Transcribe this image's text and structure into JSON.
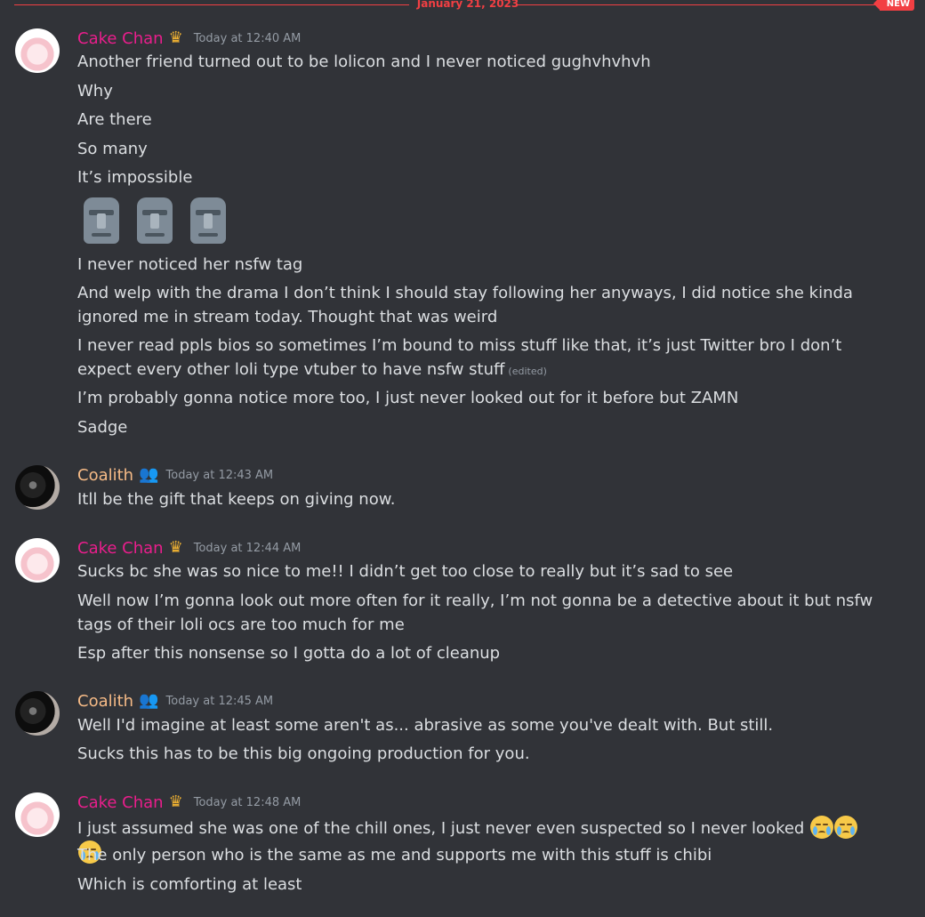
{
  "divider": {
    "date": "January 21, 2023",
    "badge": "NEW"
  },
  "groups": [
    {
      "author": "Cake Chan",
      "author_color": "#e91e8c",
      "badge_icon": "crown-icon",
      "timestamp": "Today at 12:40 AM",
      "lines": [
        "Another friend turned out to be lolicon and I never noticed gughvhvhvh",
        "Why",
        "Are there",
        "So many",
        "It’s impossible",
        "I never noticed her nsfw tag",
        "And welp with the drama I don’t think I should stay following her anyways, I did notice she kinda ignored me in stream today. Thought that was weird",
        "I never read ppls bios so sometimes I’m bound to miss stuff like that, it’s just Twitter bro I don’t expect every other loli type vtuber to have nsfw stuff",
        "I’m probably gonna notice more too, I just never looked out for it before but ZAMN",
        "Sadge"
      ],
      "edited_label": "(edited)",
      "emoji_row": [
        "moai-emoji",
        "moai-emoji",
        "moai-emoji"
      ]
    },
    {
      "author": "Coalith",
      "author_color": "#f5ba86",
      "badge_icon": "people-icon",
      "timestamp": "Today at 12:43 AM",
      "lines": [
        "Itll be the gift that keeps on giving now."
      ]
    },
    {
      "author": "Cake Chan",
      "author_color": "#e91e8c",
      "badge_icon": "crown-icon",
      "timestamp": "Today at 12:44 AM",
      "lines": [
        "Sucks bc she was so nice to me!! I didn’t get too close to really but it’s sad to see",
        "Well now I’m gonna look out more often for it really, I’m not gonna be a detective about it but nsfw tags of their loli ocs are too much for me",
        "Esp after this nonsense so I gotta do a lot of cleanup"
      ]
    },
    {
      "author": "Coalith",
      "author_color": "#f5ba86",
      "badge_icon": "people-icon",
      "timestamp": "Today at 12:45 AM",
      "lines": [
        "Well I'd imagine at least some aren't as... abrasive as some you've dealt with. But still.",
        "Sucks this has to be this big ongoing production for you."
      ]
    },
    {
      "author": "Cake Chan",
      "author_color": "#e91e8c",
      "badge_icon": "crown-icon",
      "timestamp": "Today at 12:48 AM",
      "lines": [
        "I just assumed she was one of the chill ones, I just never even suspected so I never looked",
        "The only person who is the same as me and supports me with this stuff is chibi",
        "Which is comforting at least"
      ],
      "trailing_emoji": [
        "crying-face-emoji",
        "crying-face-emoji",
        "crying-face-emoji"
      ]
    }
  ]
}
